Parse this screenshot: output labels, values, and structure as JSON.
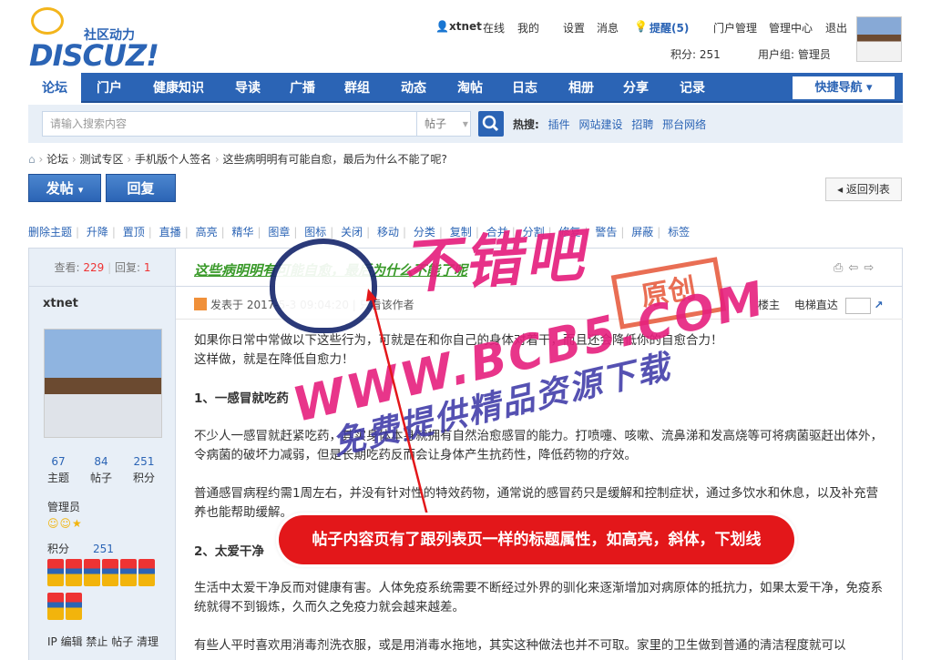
{
  "header": {
    "logo_sub": "社区动力",
    "logo_text": "DISCUZ!",
    "user": "xtnet",
    "online": "在线",
    "links": [
      "我的",
      "设置",
      "消息"
    ],
    "remind": "提醒(5)",
    "links2": [
      "门户管理",
      "管理中心",
      "退出"
    ],
    "credit": "积分: 251",
    "usergroup": "用户组: 管理员"
  },
  "nav": {
    "items": [
      "论坛",
      "门户",
      "健康知识",
      "导读",
      "广播",
      "群组",
      "动态",
      "淘帖",
      "日志",
      "相册",
      "分享",
      "记录"
    ],
    "quick": "快捷导航"
  },
  "search": {
    "placeholder": "请输入搜索内容",
    "type": "帖子",
    "hot_label": "热搜:",
    "hot": [
      "插件",
      "网站建设",
      "招聘",
      "邢台网络"
    ]
  },
  "breadcrumb": [
    "论坛",
    "测试专区",
    "手机版个人签名",
    "这些病明明有可能自愈，最后为什么不能了呢?"
  ],
  "actions": {
    "post": "发帖",
    "reply": "回复",
    "back": "返回列表"
  },
  "modbar": [
    "删除主题",
    "升降",
    "置顶",
    "直播",
    "高亮",
    "精华",
    "图章",
    "图标",
    "关闭",
    "移动",
    "分类",
    "复制",
    "合并",
    "分割",
    "修复",
    "警告",
    "屏蔽",
    "标签"
  ],
  "sidebar": {
    "views_label": "查看:",
    "views": "229",
    "replies_label": "回复:",
    "replies": "1",
    "username": "xtnet",
    "stats": [
      {
        "num": "67",
        "label": "主题"
      },
      {
        "num": "84",
        "label": "帖子"
      },
      {
        "num": "251",
        "label": "积分"
      }
    ],
    "group": "管理员",
    "stars": "☺☺★",
    "credit_label": "积分",
    "credit": "251",
    "ops": "IP 编辑 禁止 帖子 清理"
  },
  "post": {
    "title": "这些病明明有可能自愈，最后为什么不能了呢",
    "meta": "发表于 2017-5-3 09:04:20 | 只看该作者",
    "floor": "楼主",
    "jump": "电梯直达",
    "paragraphs": [
      "如果你日常中常做以下这些行为，可就是在和你自己的身体对着干，而且还会降低你的自愈合力！",
      "这样做，就是在降低自愈力！",
      "1、一感冒就吃药",
      "不少人一感冒就赶紧吃药，其实身体本身就拥有自然治愈感冒的能力。打喷嚏、咳嗽、流鼻涕和发高烧等可将病菌驱赶出体外，令病菌的破坏力减弱，但是长期吃药反而会让身体产生抗药性，降低药物的疗效。",
      "普通感冒病程约需1周左右，并没有针对性的特效药物，通常说的感冒药只是缓解和控制症状，通过多饮水和休息，以及补充营养也能帮助缓解。",
      "2、太爱干净",
      "生活中太爱干净反而对健康有害。人体免疫系统需要不断经过外界的驯化来逐渐增加对病原体的抵抗力，如果太爱干净，免疫系统就得不到锻炼，久而久之免疫力就会越来越差。",
      "有些人平时喜欢用消毒剂洗衣服，或是用消毒水拖地，其实这种做法也并不可取。家里的卫生做到普通的清洁程度就可以"
    ]
  },
  "annotation": "帖子内容页有了跟列表页一样的标题属性，如高亮，斜体，下划线",
  "watermark": {
    "big": "不错吧",
    "url": "WWW.BCB5.COM",
    "sub": "免费提供精品资源下载",
    "stamp": "原创"
  },
  "colors": {
    "brand": "#2b64b5",
    "title_green": "#3a9a2a",
    "annotation_red": "#e3171a",
    "watermark_pink": "#e6207e"
  }
}
